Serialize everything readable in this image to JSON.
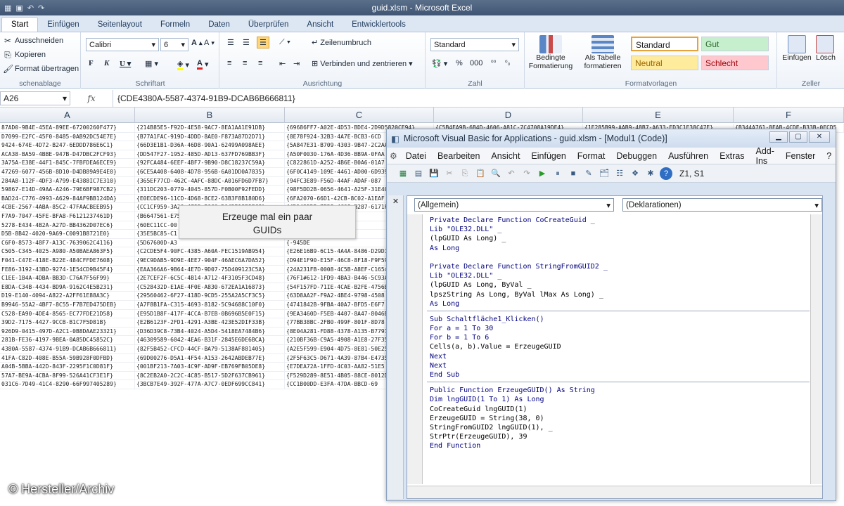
{
  "window_title": "guid.xlsm - Microsoft Excel",
  "ribbon_tabs": [
    "Start",
    "Einfügen",
    "Seitenlayout",
    "Formeln",
    "Daten",
    "Überprüfen",
    "Ansicht",
    "Entwicklertools"
  ],
  "clipboard": {
    "cut": "Ausschneiden",
    "copy": "Kopieren",
    "format": "Format übertragen",
    "label": "schenablage"
  },
  "font": {
    "name": "Calibri",
    "size": "6",
    "label": "Schriftart"
  },
  "alignment": {
    "wrap": "Zeilenumbruch",
    "merge": "Verbinden und zentrieren",
    "label": "Ausrichtung"
  },
  "number": {
    "format": "Standard",
    "label": "Zahl"
  },
  "styles": {
    "cond": "Bedingte Formatierung",
    "table": "Als Tabelle formatieren",
    "standard": "Standard",
    "good": "Gut",
    "neutral": "Neutral",
    "bad": "Schlecht",
    "label": "Formatvorlagen"
  },
  "cells_grp": {
    "insert": "Einfügen",
    "delete": "Lösch",
    "label": "Zeller"
  },
  "formula_bar": {
    "name_box": "A26",
    "fx": "fx",
    "formula": "{CDE4380A-5587-4374-91B9-DCAB6B666811}"
  },
  "columns": [
    "A",
    "B",
    "C",
    "D",
    "E",
    "F"
  ],
  "tooltip": {
    "line1": "Erzeuge mal ein paar",
    "line2": "GUIDs"
  },
  "col_a": [
    "87AD0-9B4E-45EA-89EE-67200260F477}",
    "D7099-E2FC-45F0-8485-0AB92DC54E7E}",
    "9424-674E-4D72-B247-6EDDD786E6C1}",
    "ACA38-BA59-4BBE-947B-D47DBC2FCF93}",
    "3A75A-E38E-44F1-845C-7FBFDEA6ECE9}",
    "47269-6077-456B-8D10-D4DB89A9E4E0}",
    "284A8-112F-4DF3-A799-E4388IC7E310}",
    "59867-E14D-49AA-A246-79E6BF987CB2}",
    "BAD24-C776-4993-A629-84AF9BB124DA}",
    "4CBE-2567-4ABA-85C2-47FAACBEEB95}",
    "F7A9-7047-45FE-BFA8-F6121237461D}",
    "5278-E434-4B2A-A27D-BB4362D07EC6}",
    "D5B-8B42-4020-9A69-C0091B8721E0}",
    "C6F0-8573-48F7-A13C-7639062C4116}",
    "C505-C345-4025-A980-A50BAEA863F5}",
    "F041-C47E-418E-B22E-484CFFDE7608}",
    "FE86-3192-43BD-9274-1E54CD9B45F4}",
    "C1EE-1B4A-4DBA-BB3D-C76A7F56F99}",
    "E8DA-C34B-4434-BD9A-9162C4E5B231}",
    "D19-E140-4094-A822-A2FF61E88A3C}",
    "B9946-55A2-4BF7-8C55-F7B7ED475DEB}",
    "C528-EA90-4DE4-8565-EC77FDE21D58}",
    "39D2-7175-4427-9CCB-B1C7F5D81B}",
    "926D9-0415-497D-A2C1-0B8DAAE23321}",
    "281B-FE36-4197-9BEA-0A85DC45852C}",
    "4380A-5587-4374-91B9-DCAB6B666811}",
    "41FA-C82D-408E-B55A-59B928F0DFBD}",
    "A04B-5BBA-442D-843F-2295F1C0D81F}",
    "57A7-BE9A-4CBA-8F99-526A41CF3E1F}",
    "031C6-7D49-41C4-8290-66F997405289}"
  ],
  "col_b": [
    "{214B85E5-F92D-4E58-9AC7-8EA1AA1E91DB}",
    "{B77A1FAC-919D-4DDD-8AE0-F873A87D2D71}",
    "{66D3E1B1-D36A-46D8-90A1-62499A098AEE}",
    "{DD547F27-1952-485D-AD13-637FD769BB3F}",
    "{92FCA484-6EEF-4BF7-9B90-D8C18237C59A}",
    "{6CE5A408-6408-4D78-956B-6A01DD0A7835}",
    "{365EF77CD-462C-4AFC-88DC-A016FD6D7FB7}",
    "{311DC203-0779-4045-857D-F0B00F92FEDD}",
    "{E0ECDE96-11CD-4D68-8CE2-63B3F8B180D6}",
    "{CC1CF959-3A20-4795-B6C6-D04DB18B5EC8}",
    "{B6647561-E75",
    "{60EC11CC-00",
    "{35E5BC85-C1",
    "{5D67600D-A3",
    "{C2CDE5F4-90FC-4385-A60A-FEC1519AB954}",
    "{9EC9DAB5-9D9E-4EE7-904F-46AEC6A7DA52}",
    "{EAA366A6-9B64-4E7D-9D07-75D409123C5A}",
    "{2E7CEF2F-6C5C-4B14-A712-4F3105F3CD48}",
    "{C528432D-E1AE-4F0E-A830-672EA1A16873}",
    "{29560462-6F27-418D-9CD5-255A2A5CF3C5}",
    "{A7F8B1FA-C315-4693-8182-5C94688C10F0}",
    "{E95D1B8F-417F-4CCA-B7EB-0B696B5E0F15}",
    "{E2B6123F-2FD1-4291-A3BE-423E52DIF33B}",
    "{D36D39C8-73B4-4024-A5D4-5418EA7484B6}",
    "{46309589-6042-4EA6-B31F-2845E6DE6BCA}",
    "{82F5B452-CFCD-44CF-BA79-5138AF881405}",
    "{69D00276-D5A1-4F54-A153-2642ABDEB77E}",
    "{001BF213-7A03-4C9F-AD9F-EB769FB05DE8}",
    "{8C2EB2A0-2C2C-4C85-B517-5D2F637CB961}",
    "{3BCB7E49-392F-477A-A7C7-0EDF699CC841}"
  ],
  "col_c": [
    "{69686FF7-A02E-4D53-BDE4-2D9D5820CE94}",
    "{8E78F924-32B3-4A7E-BCB3-6CD",
    "{5A847E31-B709-4303-9B47-2C2AA",
    "{A50F0030-176A-4D36-BB9A-0FAA",
    "{C822861D-A252-4B6E-B0A6-01A7",
    "{6F0C4149-109E-4461-AD00-6D9392",
    "{94FC3E89-F56D-44AF-ADAF-087",
    "{98F5DD2B-0656-4641-A25F-31E40",
    "{6FA2070-66D1-42CB-8C02-A1EAF",
    "{4D1425DB-7E58-4C08-B287-6171F",
    "{B1C6E4A6-3B",
    "{A54-3AE2",
    "{9-CAEB",
    "{-945DE",
    "{E26E16B9-6C15-4A4A-8486-D29D1",
    "{D94E1F90-E15F-46C8-8F18-F9F59",
    "{24A231FB-0008-4C5B-A8EF-C1654",
    "{76F1#612-1FD9-4BA3-B446-5C93A",
    "{54F157FD-71IE-4CAE-B2FE-4756B",
    "{63D8AA2F-F9A2-4BE4-9798-4508",
    "{4741842B-9FBA-40A7-BFD5-E6F7",
    "{9EA3460D-F5EB-4407-8A47-8046E",
    "{77BB38BC-2FB0-499F-801F-8D78",
    "{8E04A281-FD88-4378-A135-B7791",
    "{210BF36B-C9A5-4908-A1E8-27F35",
    "{A2E5F599-E904-4D75-8E81-50E25",
    "{2F5F63C5-D671-4A39-87B4-E4735",
    "{E7DEA72A-1FFD-4C03-AA82-51E5",
    "{F529D289-8E51-4B05-88CE-8012D",
    "{CC1B00DD-E3FA-47DA-BBCD-69"
  ],
  "col_d": [
    "{C5B4EA9B-6B4D-4606-A81C-7C4708A19DE4}"
  ],
  "col_e": [
    "{1E285B99-AAB9-48B7-A633-ED3C1E38C47E}"
  ],
  "col_f": [
    "{B344A761-8EAB-4CDE-B33B-0FCD5"
  ],
  "vbe": {
    "title": "Microsoft Visual Basic for Applications - guid.xlsm - [Modul1 (Code)]",
    "menu": [
      "Datei",
      "Bearbeiten",
      "Ansicht",
      "Einfügen",
      "Format",
      "Debuggen",
      "Ausführen",
      "Extras",
      "Add-Ins",
      "Fenster",
      "?"
    ],
    "position": "Z1, S1",
    "object_dropdown": "(Allgemein)",
    "proc_dropdown": "(Deklarationen)",
    "code_block1": [
      "Private Declare Function CoCreateGuid _",
      "Lib \"OLE32.DLL\" _",
      "(lpGUID As Long) _",
      "As Long",
      "",
      "Private Declare Function StringFromGUID2 _",
      "Lib \"OLE32.DLL\" _",
      "(lpGUID As Long, ByVal _",
      "lpszString As Long, ByVal lMax As Long) _",
      "As Long"
    ],
    "code_block2": [
      "Sub Schaltfläche1_Klicken()",
      "For a = 1 To 30",
      "For b = 1 To 6",
      "Cells(a, b).Value = ErzeugeGUID",
      "Next",
      "Next",
      "End Sub"
    ],
    "code_block3": [
      "Public Function ErzeugeGUID() As String",
      "Dim lngGUID(1 To 1) As Long",
      "CoCreateGuid lngGUID(1)",
      "ErzeugeGUID = String(38, 0)",
      "StringFromGUID2 lngGUID(1), _",
      "StrPtr(ErzeugeGUID), 39",
      "End Function"
    ]
  },
  "watermark": "© Hersteller/Archiv"
}
